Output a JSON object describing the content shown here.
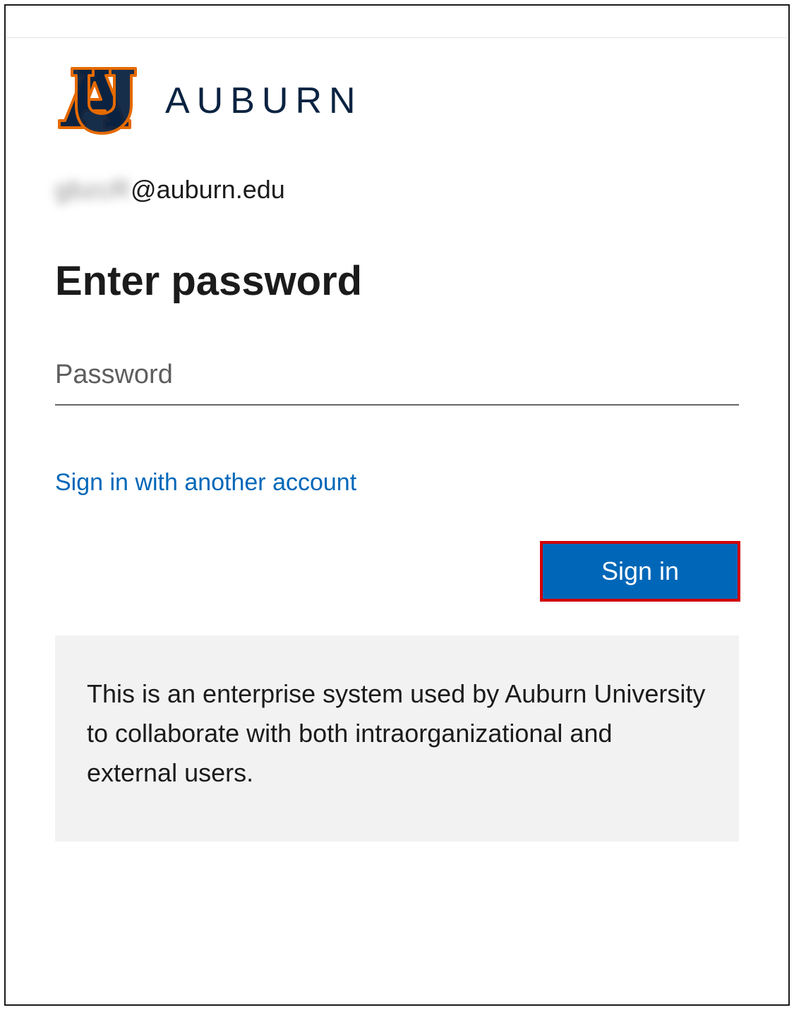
{
  "logo": {
    "wordmark": "AUBURN",
    "colors": {
      "navy": "#0b2341",
      "orange": "#e56a00"
    }
  },
  "account": {
    "username_obscured": "gbzcR",
    "domain": "@auburn.edu"
  },
  "heading": "Enter password",
  "password": {
    "placeholder": "Password",
    "value": ""
  },
  "links": {
    "another_account": "Sign in with another account"
  },
  "buttons": {
    "signin": "Sign in"
  },
  "disclaimer": "This is an enterprise system used by Auburn University to collaborate with both intraorganizational and external users."
}
